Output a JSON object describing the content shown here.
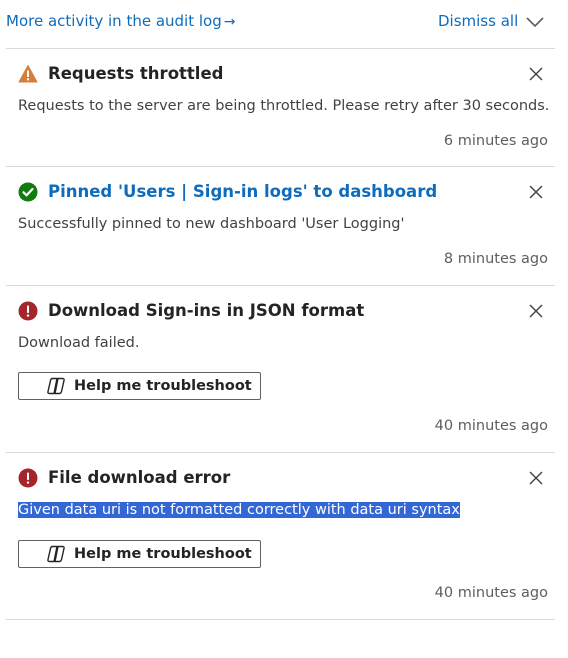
{
  "header": {
    "audit_link_label": "More activity in the audit log",
    "audit_link_arrow": "→",
    "dismiss_all_label": "Dismiss all"
  },
  "notifications": [
    {
      "status": "warning",
      "icon": "warning-triangle-icon",
      "title": "Requests throttled",
      "description": "Requests to the server are being throttled. Please retry after 30 seconds.",
      "time": "6 minutes ago"
    },
    {
      "status": "success",
      "icon": "checkmark-circle-icon",
      "title": "Pinned 'Users | Sign-in logs' to dashboard",
      "description": "Successfully pinned to new dashboard 'User Logging'",
      "time": "8 minutes ago"
    },
    {
      "status": "error",
      "icon": "error-circle-icon",
      "title": "Download Sign-ins in JSON format",
      "description": "Download failed.",
      "action_label": "Help me troubleshoot",
      "time": "40 minutes ago"
    },
    {
      "status": "error",
      "icon": "error-circle-icon",
      "title": "File download error",
      "description": "Given data uri is not formatted correctly with data uri syntax",
      "action_label": "Help me troubleshoot",
      "time": "40 minutes ago"
    }
  ],
  "colors": {
    "link": "#0f6cbd",
    "warning": "#d67f3c",
    "success": "#107c10",
    "error": "#a4262c",
    "selection": "#3367d6",
    "divider": "#d9d9d9"
  }
}
